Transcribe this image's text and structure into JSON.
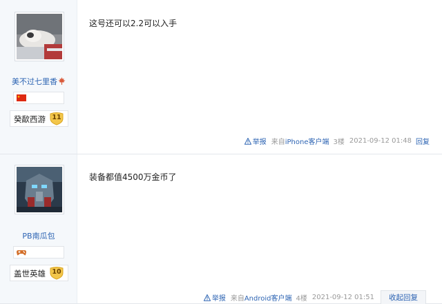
{
  "posts": [
    {
      "username": "美不过七里香",
      "username_badge_icon": "maple-leaf-icon",
      "flag_icon": "china-flag-icon",
      "level_name": "癸歃西游",
      "level_number": "11",
      "content": "这号还可以2.2可以入手",
      "report_label": "举报",
      "via_prefix": "来自",
      "via_client": "iPhone客户端",
      "floor": "3楼",
      "time": "2021-09-12 01:48",
      "reply_label": "回复"
    },
    {
      "username": "PB南瓜包",
      "flag_icon": "gamepad-icon",
      "level_name": "盖世英雄",
      "level_number": "10",
      "content": "装备都值4500万金币了",
      "report_label": "举报",
      "via_prefix": "来自",
      "via_client": "Android客户端",
      "floor": "4楼",
      "time": "2021-09-12 01:51",
      "reply_label": "收起回复"
    }
  ],
  "colors": {
    "link": "#2d64b3",
    "meta": "#999999",
    "author_bg": "#f5f8fb",
    "level_badge": "#f3c64a"
  }
}
